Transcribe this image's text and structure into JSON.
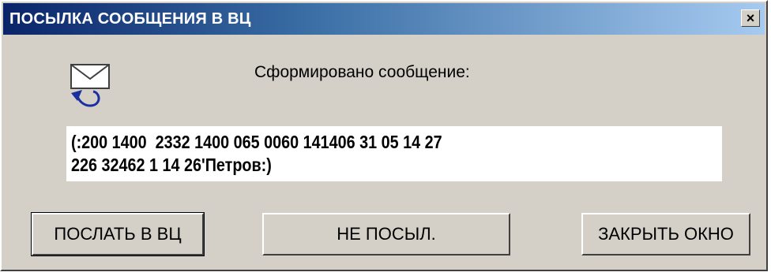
{
  "window": {
    "title": "ПОСЫЛКА СООБЩЕНИЯ В ВЦ",
    "close_glyph": "×",
    "close_icon": "close-icon"
  },
  "content": {
    "icon": "envelope-send-icon",
    "caption": "Сформировано сообщение:",
    "message_lines": [
      "(:200 1400  2332 1400 065 0060 141406 31 05 14 27",
      "226 32462 1 14 26'Петров:)"
    ]
  },
  "buttons": {
    "send_label": "ПОСЛАТЬ В ВЦ",
    "no_send_label": "НЕ ПОСЫЛ.",
    "close_label": "ЗАКРЫТЬ ОКНО"
  },
  "colors": {
    "title_start": "#0a246a",
    "title_end": "#a6caf0",
    "face": "#d4d0c8"
  }
}
